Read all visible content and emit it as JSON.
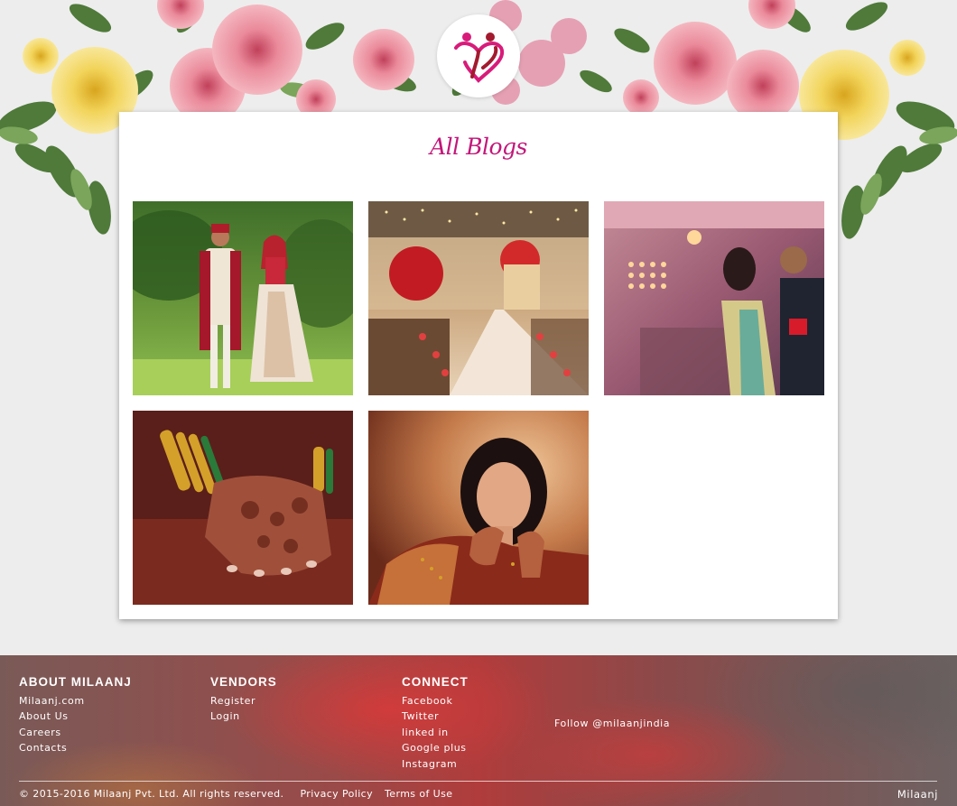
{
  "header": {
    "logo_icon": "couple-heart-logo-icon"
  },
  "page": {
    "title": "All Blogs"
  },
  "blogs": [
    {
      "image": "wedding-couple-garden-photo"
    },
    {
      "image": "wedding-hall-decor-photo"
    },
    {
      "image": "couple-dancing-reception-photo"
    },
    {
      "image": "mehndi-hands-bangles-photo"
    },
    {
      "image": "bride-portrait-photo"
    }
  ],
  "footer": {
    "about": {
      "heading": "ABOUT MILAANJ",
      "links": [
        "Milaanj.com",
        "About Us",
        "Careers",
        "Contacts"
      ]
    },
    "vendors": {
      "heading": "VENDORS",
      "links": [
        "Register",
        "Login"
      ]
    },
    "connect": {
      "heading": "CONNECT",
      "links": [
        "Facebook",
        "Twitter",
        "linked in",
        "Google plus",
        "Instagram"
      ]
    },
    "follow": "Follow @milaanjindia",
    "copyright": "© 2015-2016 Milaanj Pvt. Ltd. All rights reserved.",
    "privacy": "Privacy Policy",
    "terms": "Terms of Use",
    "brand": "Milaanj"
  },
  "colors": {
    "accent": "#c2177a",
    "background": "#ededed"
  }
}
